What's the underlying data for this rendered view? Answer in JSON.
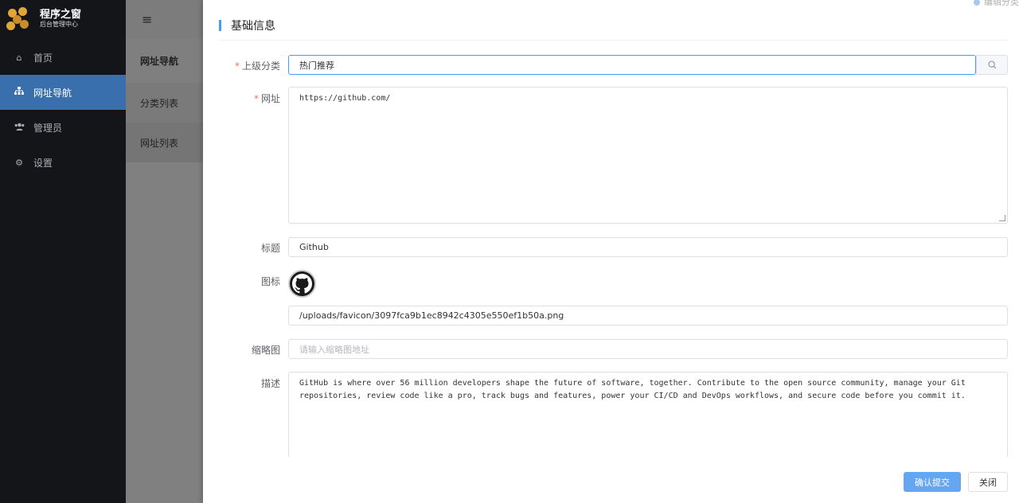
{
  "app": {
    "title": "程序之窗",
    "subtitle": "后台管理中心"
  },
  "sidebar": {
    "items": [
      {
        "label": "首页",
        "icon": "home-icon"
      },
      {
        "label": "网址导航",
        "icon": "sitemap-icon",
        "active": true
      },
      {
        "label": "管理员",
        "icon": "users-icon"
      },
      {
        "label": "设置",
        "icon": "gear-icon"
      }
    ]
  },
  "submenu": {
    "title": "网址导航",
    "items": [
      {
        "label": "分类列表"
      },
      {
        "label": "网址列表"
      }
    ]
  },
  "topbar": {
    "menu_icon": "≡"
  },
  "panel": {
    "corner_tag": "编辑分类",
    "section_title": "基础信息",
    "parent_category": {
      "label": "上级分类",
      "value": "热门推荐"
    },
    "url": {
      "label": "网址",
      "value": "https://github.com/"
    },
    "title": {
      "label": "标题",
      "value": "Github"
    },
    "icon": {
      "label": "图标",
      "value": "/uploads/favicon/3097fca9b1ec8942c4305e550ef1b50a.png"
    },
    "thumbnail": {
      "label": "缩略图",
      "placeholder": "请输入缩略图地址"
    },
    "description": {
      "label": "描述",
      "value": "GitHub is where over 56 million developers shape the future of software, together. Contribute to the open source community, manage your Git repositories, review code like a pro, track bugs and features, power your CI/CD and DevOps workflows, and secure code before you commit it."
    },
    "buttons": {
      "submit": "确认提交",
      "close": "关闭"
    }
  },
  "colors": {
    "accent": "#409eff",
    "sidebar_bg": "#141519",
    "active_bg": "#3a6fad",
    "required": "#f56c6c"
  }
}
